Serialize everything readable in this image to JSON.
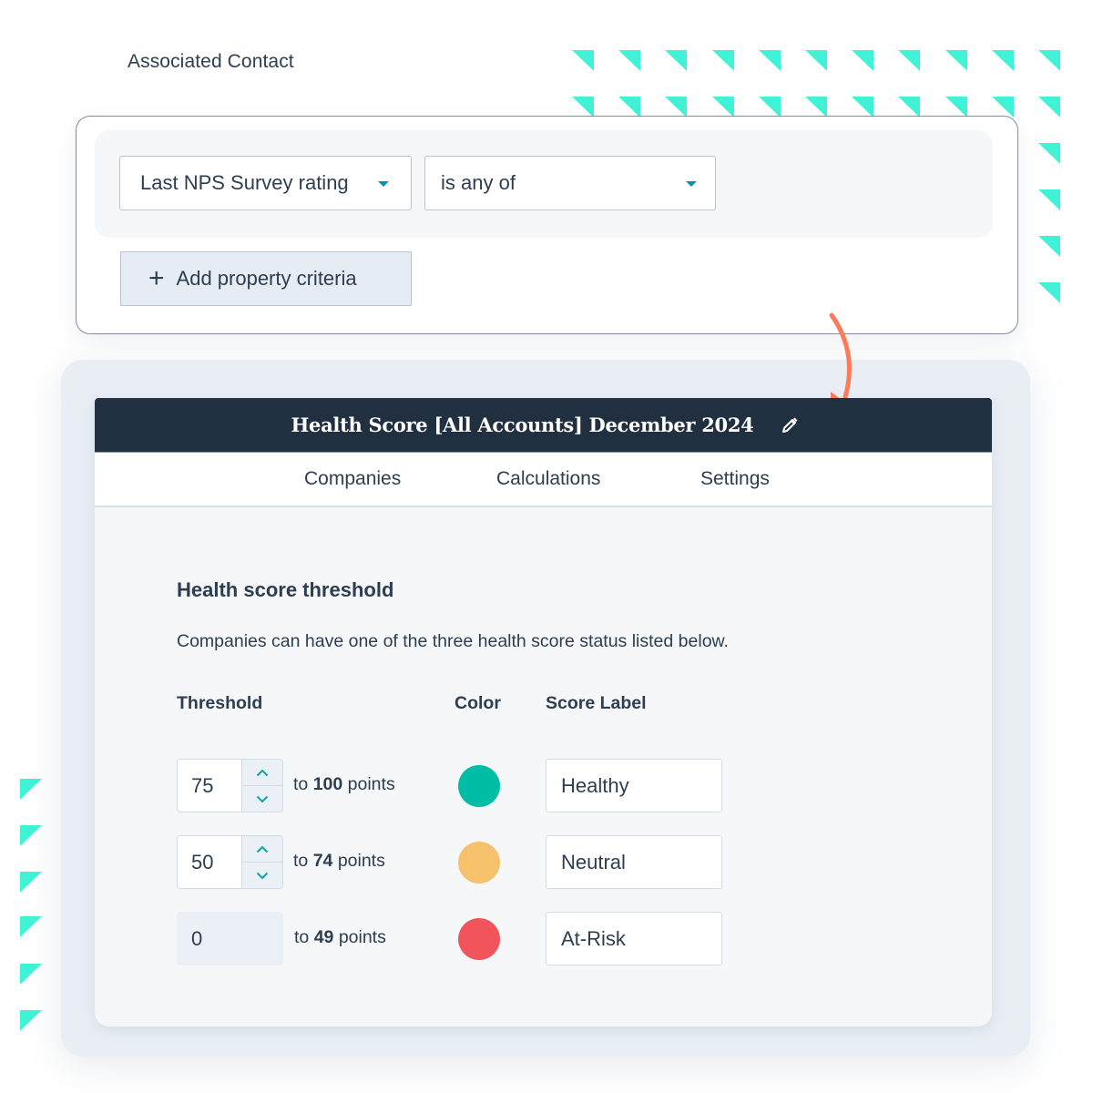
{
  "filter": {
    "section_label": "Associated Contact",
    "property_select": {
      "value": "Last NPS Survey rating",
      "icon": "caret-down-icon"
    },
    "operator_select": {
      "value": "is any of",
      "icon": "caret-down-icon"
    },
    "add_button": {
      "label": "Add property criteria",
      "icon": "plus-icon"
    }
  },
  "health_score": {
    "title": "Health Score [All Accounts] December 2024",
    "edit_icon": "pencil-icon",
    "tabs": [
      {
        "label": "Companies"
      },
      {
        "label": "Calculations"
      },
      {
        "label": "Settings"
      }
    ],
    "section_title": "Health score threshold",
    "section_description": "Companies can have one of the three health score status listed below.",
    "columns": {
      "threshold": "Threshold",
      "color": "Color",
      "score_label": "Score Label"
    },
    "rows": [
      {
        "min": "75",
        "to_prefix": "to",
        "max": "100",
        "suffix": "points",
        "color": "#00bda5",
        "label": "Healthy",
        "editable": true
      },
      {
        "min": "50",
        "to_prefix": "to",
        "max": "74",
        "suffix": "points",
        "color": "#f5c26b",
        "label": "Neutral",
        "editable": true
      },
      {
        "min": "0",
        "to_prefix": "to",
        "max": "49",
        "suffix": "points",
        "color": "#f2545b",
        "label": "At-Risk",
        "editable": false
      }
    ]
  },
  "colors": {
    "accent_teal": "#40f3d6",
    "header_dark": "#213040",
    "arrow_orange": "#ff7a59",
    "caret_blue": "#0891b2"
  }
}
